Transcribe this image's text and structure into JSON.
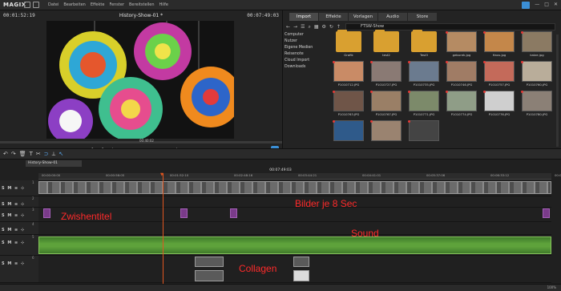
{
  "app": {
    "logo": "MAGIX",
    "menu": [
      "Datei",
      "Bearbeiten",
      "Effekte",
      "Fenster",
      "Bereitstellen",
      "Hilfe"
    ]
  },
  "preview": {
    "title": "History-Show-01 *",
    "timecode_left": "00:01:52:19",
    "timecode_right": "00:07:49:03",
    "scrub_timecode": "00:40:02",
    "transport": [
      "[",
      "]",
      "|◀",
      "◀◀",
      "▶",
      "▶▶",
      "▶|"
    ]
  },
  "media": {
    "tabs": [
      "Import",
      "Effekte",
      "Vorlagen",
      "Audio",
      "Store"
    ],
    "active_tab": "Import",
    "path": "FTSW-Show",
    "tree": [
      "Computer",
      "Nutzer",
      "Eigene Medien",
      "Reisenote",
      "Cloud Import",
      "Downloads"
    ],
    "items": [
      {
        "label": "Grafik",
        "kind": "folder"
      },
      {
        "label": "test2",
        "kind": "folder"
      },
      {
        "label": "Test3",
        "kind": "folder"
      },
      {
        "label": "geburek.jpg",
        "kind": "image",
        "color": "#b58b63"
      },
      {
        "label": "Haus.jpg",
        "kind": "image",
        "color": "#c4874a"
      },
      {
        "label": "katze.jpg",
        "kind": "image",
        "color": "#8b7a63"
      },
      {
        "label": "P1010712.JPG",
        "kind": "image",
        "color": "#c98b66"
      },
      {
        "label": "P1010727.JPG",
        "kind": "image",
        "color": "#8a7a74"
      },
      {
        "label": "P1010735.JPG",
        "kind": "image",
        "color": "#6b7b8f"
      },
      {
        "label": "P1010746.JPG",
        "kind": "image",
        "color": "#a07c65"
      },
      {
        "label": "P1010757.JPG",
        "kind": "image",
        "color": "#c46a5a"
      },
      {
        "label": "P1010760.JPG",
        "kind": "image",
        "color": "#b9ad9a"
      },
      {
        "label": "P1010763.JPG",
        "kind": "image",
        "color": "#6f5548"
      },
      {
        "label": "P1010767.JPG",
        "kind": "image",
        "color": "#9a7f66"
      },
      {
        "label": "P1010771.JPG",
        "kind": "image",
        "color": "#7c8a6a"
      },
      {
        "label": "P1010774.JPG",
        "kind": "image",
        "color": "#8f9d87"
      },
      {
        "label": "P1010776.JPG",
        "kind": "image",
        "color": "#cfcfcf"
      },
      {
        "label": "P1010780.JPG",
        "kind": "image",
        "color": "#8b8076"
      },
      {
        "label": "",
        "kind": "image",
        "color": "#2f5a8a"
      },
      {
        "label": "",
        "kind": "image",
        "color": "#9a8370"
      },
      {
        "label": "",
        "kind": "image",
        "color": "#444444"
      }
    ]
  },
  "timeline": {
    "project_tab": "History-Show-01",
    "timecode": "00:07:49:03",
    "ruler": [
      "00:00:00:00",
      "00:00:56:05",
      "00:01:52:10",
      "00:02:48:16",
      "00:03:44:21",
      "00:04:41:01",
      "00:05:37:06",
      "00:06:33:12",
      "00:07:29:17"
    ],
    "tracks": [
      {
        "num": "1",
        "label": "S M ≡ ⊹"
      },
      {
        "num": "2",
        "label": "S M ≡ ⊹"
      },
      {
        "num": "3",
        "label": "S M ≡ ⊹"
      },
      {
        "num": "4",
        "label": "S M ≡ ⊹"
      },
      {
        "num": "5",
        "label": "S M ≡ ⊹"
      },
      {
        "num": "6",
        "label": "S M ≡ ⊹"
      }
    ],
    "annotations": {
      "images": "Bilder je 8 Sec",
      "titles": "Zwishentitel",
      "sound": "Sound",
      "collages": "Collagen"
    }
  },
  "status": {
    "zoom": "100%"
  }
}
